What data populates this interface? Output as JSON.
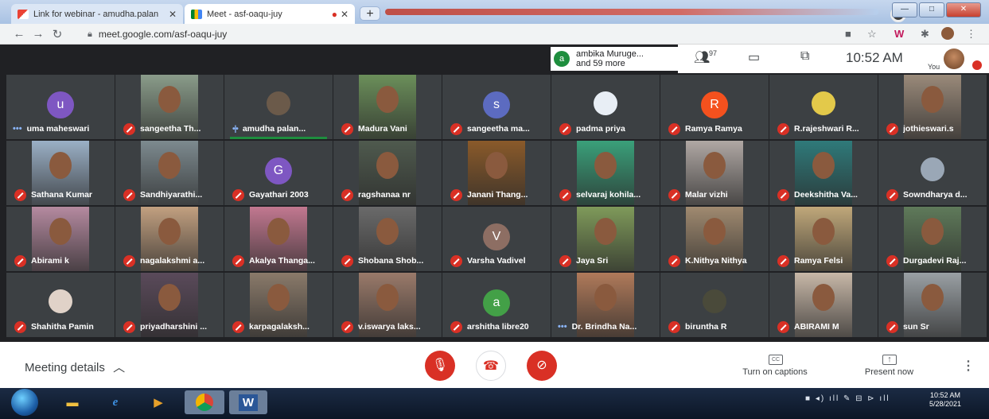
{
  "browser": {
    "tabs": [
      {
        "title": "Link for webinar - amudha.palan",
        "icon": "gmail-icon"
      },
      {
        "title": "Meet - asf-oaqu-juy",
        "icon": "meet-icon",
        "active": true
      }
    ],
    "url": "meet.google.com/asf-oaqu-juy"
  },
  "meet": {
    "presenter": {
      "avatar_letter": "a",
      "line1": "ambika Muruge...",
      "line2": "and 59 more"
    },
    "participant_count": "97",
    "time": "10:52 AM",
    "self_label": "You"
  },
  "tiles": [
    {
      "name": "uma maheswari",
      "kind": "avatar",
      "letter": "u",
      "color": "#7e57c2",
      "status": "dots"
    },
    {
      "name": "sangeetha Th...",
      "kind": "photo",
      "bg": "#8a9c8a",
      "status": "muted"
    },
    {
      "name": "amudha palan...",
      "kind": "pic",
      "bg": "#6b5a4a",
      "status": "speaking"
    },
    {
      "name": "Madura Vani",
      "kind": "photo",
      "bg": "#6b8f5a",
      "status": "muted"
    },
    {
      "name": "sangeetha ma...",
      "kind": "avatar",
      "letter": "s",
      "color": "#5c6bc0",
      "status": "muted"
    },
    {
      "name": "padma priya",
      "kind": "pic",
      "bg": "#e8eef5",
      "status": "muted"
    },
    {
      "name": "Ramya Ramya",
      "kind": "avatar",
      "letter": "R",
      "color": "#f4511e",
      "status": "muted"
    },
    {
      "name": "R.rajeshwari R...",
      "kind": "pic",
      "bg": "#e3c94a",
      "status": "muted"
    },
    {
      "name": "jothieswari.s",
      "kind": "photo",
      "bg": "#9a8a7a",
      "status": "muted"
    },
    {
      "name": "Sathana Kumar",
      "kind": "photo",
      "bg": "#9bb0c6",
      "status": "muted"
    },
    {
      "name": "Sandhiyarathi...",
      "kind": "photo",
      "bg": "#7d8a8f",
      "status": "muted"
    },
    {
      "name": "Gayathari 2003",
      "kind": "avatar",
      "letter": "G",
      "color": "#7e57c2",
      "status": "muted"
    },
    {
      "name": "ragshanaa nr",
      "kind": "photo",
      "bg": "#4f5a4e",
      "status": "muted"
    },
    {
      "name": "Janani Thang...",
      "kind": "photo",
      "bg": "#8a5a2a",
      "status": "muted"
    },
    {
      "name": "selvaraj kohila...",
      "kind": "photo",
      "bg": "#3aa07a",
      "status": "muted"
    },
    {
      "name": "Malar vizhi",
      "kind": "photo",
      "bg": "#b0a8a4",
      "status": "muted"
    },
    {
      "name": "Deekshitha Va...",
      "kind": "photo",
      "bg": "#2f7a7a",
      "status": "muted"
    },
    {
      "name": "Sowndharya d...",
      "kind": "pic",
      "bg": "#9aa7b6",
      "status": "muted"
    },
    {
      "name": "Abirami k",
      "kind": "photo",
      "bg": "#b58aa0",
      "status": "muted"
    },
    {
      "name": "nagalakshmi a...",
      "kind": "photo",
      "bg": "#c2a080",
      "status": "muted"
    },
    {
      "name": "Akalya Thanga...",
      "kind": "photo",
      "bg": "#c27890",
      "status": "muted"
    },
    {
      "name": "Shobana Shob...",
      "kind": "photo",
      "bg": "#6a6a6a",
      "status": "muted"
    },
    {
      "name": "Varsha Vadivel",
      "kind": "avatar",
      "letter": "V",
      "color": "#8d6e63",
      "status": "muted"
    },
    {
      "name": "Jaya Sri",
      "kind": "photo",
      "bg": "#7f9a5a",
      "status": "muted"
    },
    {
      "name": "K.Nithya Nithya",
      "kind": "photo",
      "bg": "#a08a70",
      "status": "muted"
    },
    {
      "name": "Ramya Felsi",
      "kind": "photo",
      "bg": "#c0a87a",
      "status": "muted"
    },
    {
      "name": "Durgadevi Raj...",
      "kind": "photo",
      "bg": "#5f7a5a",
      "status": "muted"
    },
    {
      "name": "Shahitha Pamin",
      "kind": "pic",
      "bg": "#e0d2c8",
      "status": "muted"
    },
    {
      "name": "priyadharshini ...",
      "kind": "photo",
      "bg": "#5a4a5a",
      "status": "muted"
    },
    {
      "name": "karpagalaksh...",
      "kind": "photo",
      "bg": "#8a7a6a",
      "status": "muted"
    },
    {
      "name": "v.iswarya laks...",
      "kind": "photo",
      "bg": "#9a7a6a",
      "status": "muted"
    },
    {
      "name": "arshitha libre20",
      "kind": "avatar",
      "letter": "a",
      "color": "#43a047",
      "status": "muted"
    },
    {
      "name": "Dr. Brindha Na...",
      "kind": "photo",
      "bg": "#b07a5a",
      "status": "dots"
    },
    {
      "name": "biruntha R",
      "kind": "pic",
      "bg": "#4a4a3a",
      "status": "muted"
    },
    {
      "name": "ABIRAMI M",
      "kind": "photo",
      "bg": "#c8b8a8",
      "status": "muted"
    },
    {
      "name": "sun Sr",
      "kind": "photo",
      "bg": "#9aa0a4",
      "status": "muted"
    }
  ],
  "bottom": {
    "meeting_details": "Meeting details",
    "captions_label": "Turn on captions",
    "captions_icon": "CC",
    "present_label": "Present now"
  },
  "taskbar": {
    "time": "10:52 AM",
    "date": "5/28/2021"
  },
  "colors": {
    "mute_red": "#d93025",
    "meet_dark": "#202124",
    "tile": "#3c4043"
  }
}
